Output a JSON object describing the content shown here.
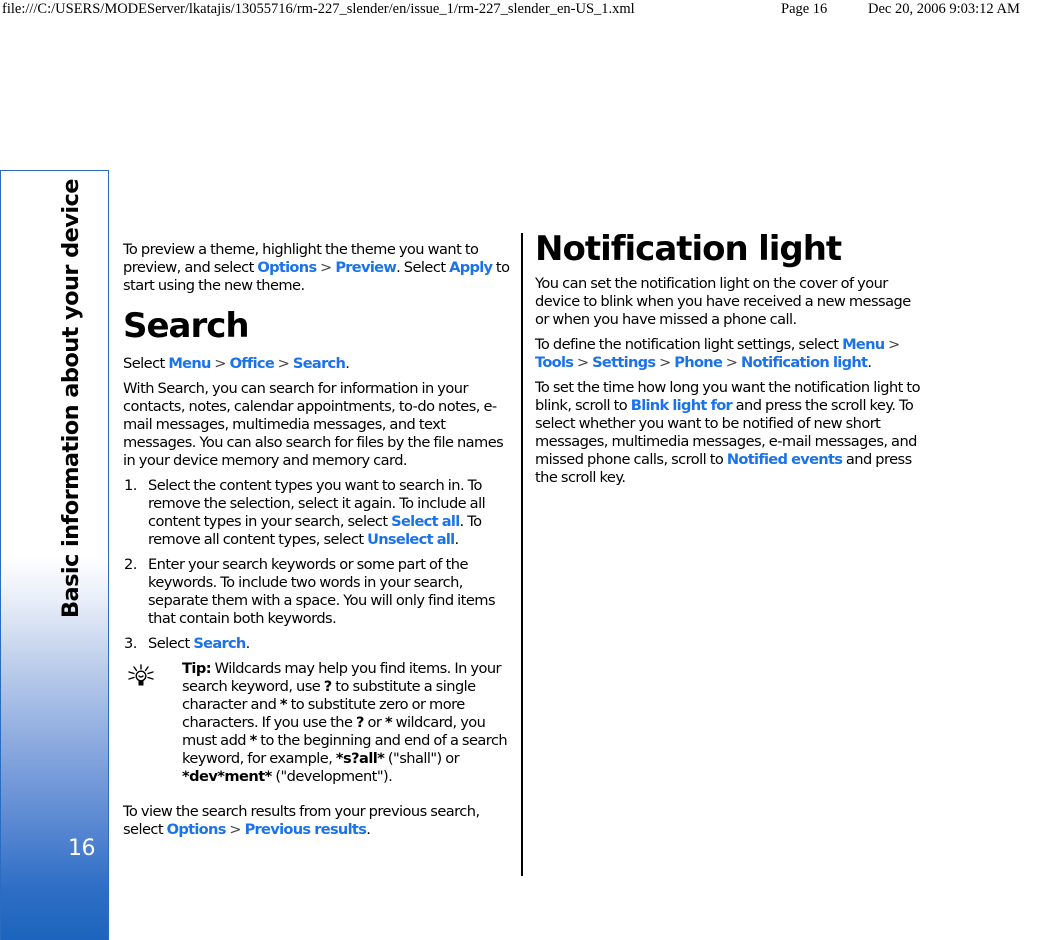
{
  "print_header": {
    "url": "file:///C:/USERS/MODEServer/lkatajis/13055716/rm-227_slender/en/issue_1/rm-227_slender_en-US_1.xml",
    "page": "Page 16",
    "date": "Dec 20, 2006 9:03:12 AM"
  },
  "side_tab": {
    "title": "Basic information about your device",
    "page_number": "16",
    "gradient_colors": [
      "#ffffff",
      "#1c64bd"
    ],
    "border_color": "#2a6cc0"
  },
  "colors": {
    "link": "#1a73e8",
    "text": "#000000"
  },
  "left_column": {
    "intro": {
      "t1": "To preview a theme, highlight the theme you want to preview, and select ",
      "l1": "Options",
      "sep1": " > ",
      "l2": "Preview",
      "t2": ". Select ",
      "l3": "Apply",
      "t3": " to start using the new theme."
    },
    "search_heading": "Search",
    "select_path": {
      "t1": "Select ",
      "l1": "Menu",
      "sep1": " > ",
      "l2": "Office",
      "sep2": " > ",
      "l3": "Search",
      "t2": "."
    },
    "description": "With Search, you can search for information in your contacts, notes, calendar appointments, to-do notes, e-mail messages, multimedia messages, and text messages. You can also search for files by the file names in your device memory and memory card.",
    "steps": [
      {
        "num": "1.",
        "t1": "Select the content types you want to search in. To remove the selection, select it again. To include all content types in your search, select ",
        "l1": "Select all",
        "t2": ". To remove all content types, select ",
        "l2": "Unselect all",
        "t3": "."
      },
      {
        "num": "2.",
        "text": "Enter your search keywords or some part of the keywords. To include two words in your search, separate them with a space. You will only find items that contain both keywords."
      },
      {
        "num": "3.",
        "t1": "Select ",
        "l1": "Search",
        "t2": "."
      }
    ],
    "tip": {
      "icon": "lightbulb-icon",
      "label": "Tip:",
      "t1": " Wildcards may help you find items. In your search keyword, use ",
      "c1": "?",
      "t2": " to substitute a single character and ",
      "c2": "*",
      "t3": " to substitute zero or more characters. If you use the ",
      "c3": "?",
      "t4": " or ",
      "c4": "*",
      "t5": " wildcard, you must add ",
      "c5": "*",
      "t6": " to the beginning and end of a search keyword, for example, ",
      "c6": "*s?all*",
      "t7": " (\"shall\") or ",
      "c7": "*dev*ment*",
      "t8": " (\"development\")."
    },
    "previous": {
      "t1": "To view the search results from your previous search, select ",
      "l1": "Options",
      "sep1": " > ",
      "l2": "Previous results",
      "t2": "."
    }
  },
  "right_column": {
    "heading": "Notification light",
    "intro": "You can set the notification light on the cover of your device to blink when you have received a new message or when you have missed a phone call.",
    "define": {
      "t1": "To define the notification light settings, select ",
      "l1": "Menu",
      "sep1": " > ",
      "l2": "Tools",
      "sep2": " > ",
      "l3": "Settings",
      "sep3": " > ",
      "l4": "Phone",
      "sep4": " > ",
      "l5": "Notification light",
      "t2": "."
    },
    "blink": {
      "t1": "To set the time how long you want the notification light to blink, scroll to ",
      "l1": "Blink light for",
      "t2": " and press the scroll key. To select whether you want to be notified of new short messages, multimedia messages, e-mail messages, and missed phone calls, scroll to ",
      "l2": "Notified events",
      "t3": " and press the scroll key."
    }
  }
}
